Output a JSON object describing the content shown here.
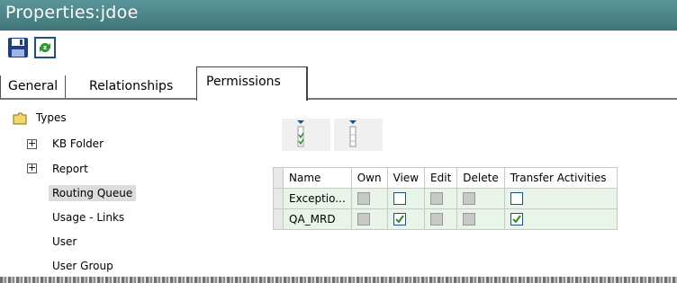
{
  "window": {
    "title": "Properties:jdoe"
  },
  "toolbar": {
    "buttons": [
      {
        "icon": "save-icon"
      },
      {
        "icon": "refresh-icon"
      }
    ]
  },
  "tabs": [
    {
      "label": "General",
      "active": false
    },
    {
      "label": "Relationships",
      "active": false
    },
    {
      "label": "Permissions",
      "active": true
    }
  ],
  "tree": {
    "root": {
      "label": "Types",
      "icon": "folder-icon"
    },
    "items": [
      {
        "label": "KB Folder",
        "expandable": true
      },
      {
        "label": "Report",
        "expandable": true
      },
      {
        "label": "Routing Queue",
        "selected": true
      },
      {
        "label": "Usage - Links"
      },
      {
        "label": "User"
      },
      {
        "label": "User Group"
      }
    ]
  },
  "permission_actions": [
    {
      "icon": "grant-all-icon"
    },
    {
      "icon": "revoke-all-icon"
    }
  ],
  "grid": {
    "columns": [
      "Name",
      "Own",
      "View",
      "Edit",
      "Delete",
      "Transfer Activities"
    ],
    "rows": [
      {
        "name": "Exceptio...",
        "own": false,
        "own_enabled": false,
        "view": false,
        "view_enabled": true,
        "edit": false,
        "edit_enabled": false,
        "delete": false,
        "delete_enabled": false,
        "transfer": false,
        "transfer_enabled": true
      },
      {
        "name": "QA_MRD",
        "own": false,
        "own_enabled": false,
        "view": true,
        "view_enabled": true,
        "edit": false,
        "edit_enabled": false,
        "delete": false,
        "delete_enabled": false,
        "transfer": true,
        "transfer_enabled": true
      }
    ]
  },
  "colors": {
    "titlebar": "#4f8a8e",
    "accent": "#1c5180",
    "check": "#2a8a2a"
  }
}
